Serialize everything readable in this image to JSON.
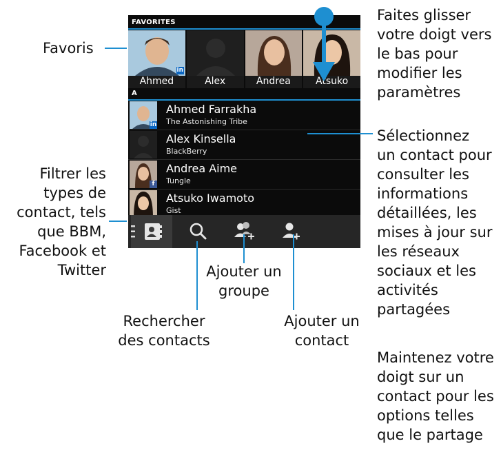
{
  "callouts": {
    "favoris": "Favoris",
    "filter": "Filtrer les\ntypes de\ncontact, tels\nque BBM,\nFacebook et\nTwitter",
    "swipe": "Faites glisser\nvotre doigt vers\nle bas pour\nmodifier les\nparamètres",
    "select": "Sélectionnez\nun contact pour\nconsulter les\ninformations\ndétaillées, les\nmises à jour sur\nles réseaux\nsociaux et les\nactivités\npartagées",
    "hold": "Maintenez votre\ndoigt sur un\ncontact pour les\noptions telles\nque le partage",
    "add_group": "Ajouter un\ngroupe",
    "search": "Rechercher\ndes contacts",
    "add_contact": "Ajouter un\ncontact"
  },
  "screen": {
    "favorites_header": "FAVORITES",
    "favorites": [
      {
        "name": "Ahmed",
        "badge": "linkedin-icon"
      },
      {
        "name": "Alex"
      },
      {
        "name": "Andrea"
      },
      {
        "name": "Atsuko"
      }
    ],
    "section_letter": "A",
    "contacts": [
      {
        "name": "Ahmed Farrakha",
        "org": "The Astonishing Tribe",
        "badge": "linkedin-icon"
      },
      {
        "name": "Alex Kinsella",
        "org": "BlackBerry"
      },
      {
        "name": "Andrea Aime",
        "org": "Tungle",
        "badge": "facebook-icon"
      },
      {
        "name": "Atsuko Iwamoto",
        "org": "Gist"
      }
    ],
    "toolbar": [
      {
        "icon": "contacts-book-icon"
      },
      {
        "icon": "search-icon"
      },
      {
        "icon": "add-group-icon"
      },
      {
        "icon": "add-contact-icon"
      }
    ]
  },
  "colors": {
    "accent": "#1e8fd1",
    "screen_bg": "#0b0b0b",
    "toolbar_bg": "#262626"
  }
}
